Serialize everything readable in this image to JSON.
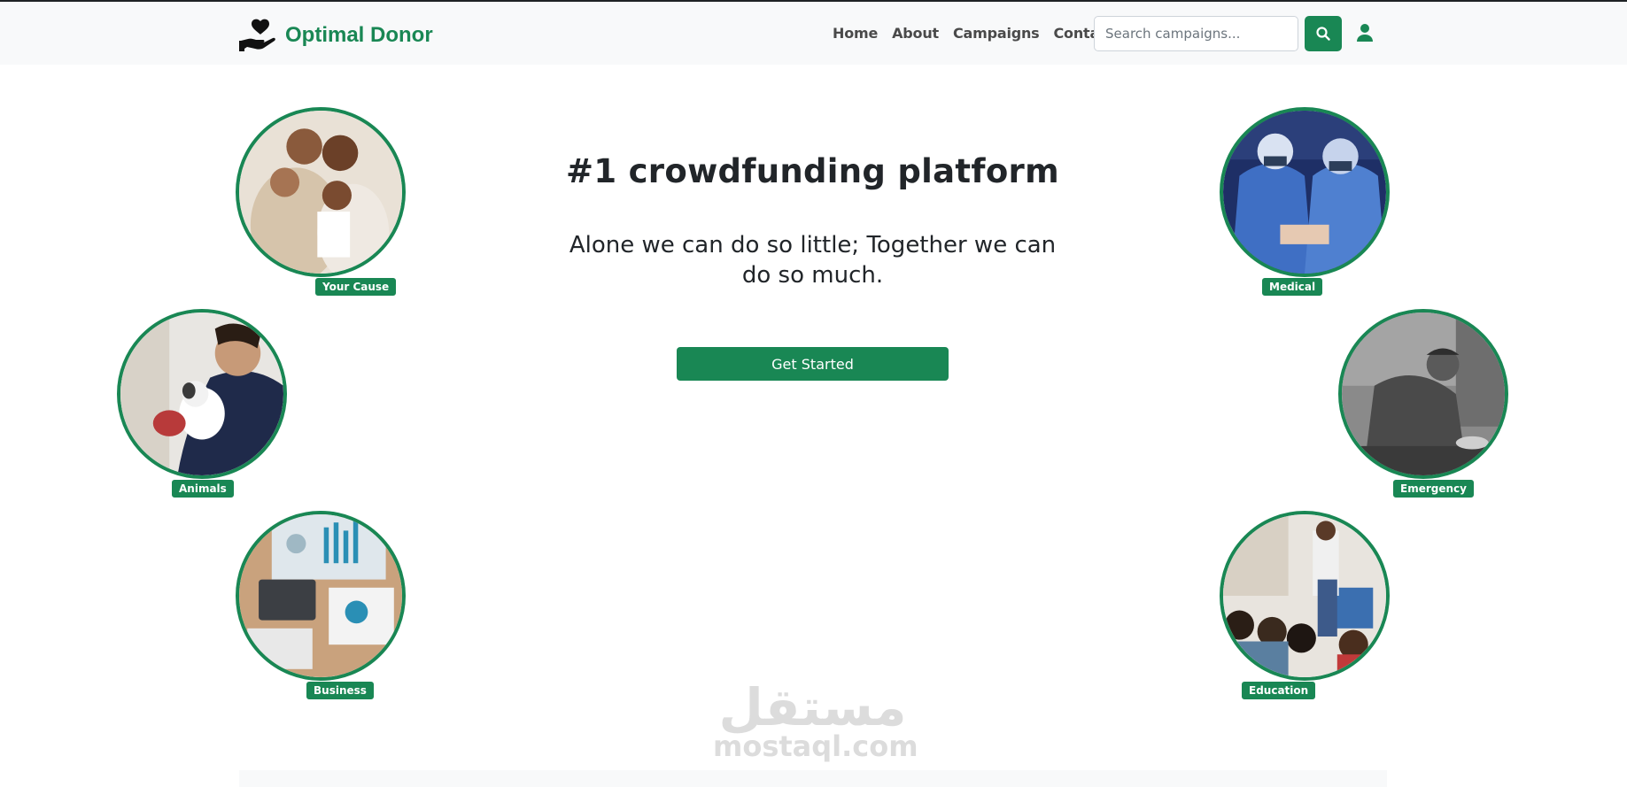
{
  "brand": {
    "name": "Optimal Donor",
    "accent": "#198754"
  },
  "nav": {
    "links": [
      "Home",
      "About",
      "Campaigns",
      "Contact"
    ]
  },
  "search": {
    "placeholder": "Search campaigns...",
    "icon": "search-icon"
  },
  "account": {
    "icon": "user-icon"
  },
  "hero": {
    "title": "#1 crowdfunding platform",
    "subtitle": "Alone we can do so little; Together we can do so much.",
    "cta": "Get Started"
  },
  "categories": [
    {
      "label": "Your Cause",
      "image": "family-hug-photo"
    },
    {
      "label": "Animals",
      "image": "person-with-cat-photo"
    },
    {
      "label": "Business",
      "image": "calculator-charts-photo"
    },
    {
      "label": "Medical",
      "image": "surgeons-operating-photo"
    },
    {
      "label": "Emergency",
      "image": "homeless-man-photo"
    },
    {
      "label": "Education",
      "image": "classroom-children-photo"
    }
  ],
  "watermark": {
    "arabic": "مستقل",
    "latin": "mostaql.com"
  }
}
